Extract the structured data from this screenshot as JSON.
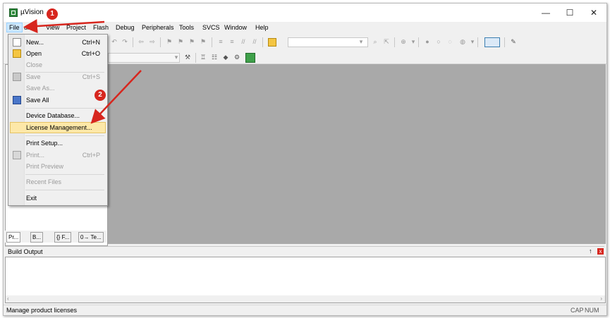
{
  "window": {
    "title": "µVision",
    "minimize": "—",
    "maximize": "☐",
    "close": "✕"
  },
  "menubar": {
    "items": [
      "File",
      "Edit",
      "View",
      "Project",
      "Flash",
      "Debug",
      "Peripherals",
      "Tools",
      "SVCS",
      "Window",
      "Help"
    ],
    "edit_visible": "dit"
  },
  "file_menu": {
    "items": [
      {
        "label": "New...",
        "shortcut": "Ctrl+N",
        "enabled": true,
        "icon": "new-file-icon"
      },
      {
        "label": "Open",
        "shortcut": "Ctrl+O",
        "enabled": true,
        "icon": "open-folder-icon"
      },
      {
        "label": "Close",
        "shortcut": "",
        "enabled": false,
        "icon": ""
      },
      {
        "label": "Save",
        "shortcut": "Ctrl+S",
        "enabled": false,
        "icon": "save-icon"
      },
      {
        "label": "Save As...",
        "shortcut": "",
        "enabled": false,
        "icon": ""
      },
      {
        "label": "Save All",
        "shortcut": "",
        "enabled": true,
        "icon": "save-all-icon"
      },
      {
        "label": "Device Database...",
        "shortcut": "",
        "enabled": true,
        "icon": ""
      },
      {
        "label": "License Management...",
        "shortcut": "",
        "enabled": true,
        "highlighted": true,
        "icon": ""
      },
      {
        "label": "Print Setup...",
        "shortcut": "",
        "enabled": true,
        "icon": ""
      },
      {
        "label": "Print...",
        "shortcut": "Ctrl+P",
        "enabled": false,
        "icon": "print-icon"
      },
      {
        "label": "Print Preview",
        "shortcut": "",
        "enabled": false,
        "icon": ""
      },
      {
        "label": "Recent Files",
        "shortcut": "",
        "enabled": false,
        "icon": ""
      },
      {
        "label": "Exit",
        "shortcut": "",
        "enabled": true,
        "icon": ""
      }
    ]
  },
  "panel_tabs": [
    {
      "label": "Pr...",
      "icon": "project-icon"
    },
    {
      "label": "B...",
      "icon": "books-icon"
    },
    {
      "label": "{} F...",
      "icon": "functions-icon"
    },
    {
      "label": "0→ Te...",
      "icon": "templates-icon"
    }
  ],
  "build_output": {
    "title": "Build Output",
    "pin": "↑",
    "close": "x"
  },
  "statusbar": {
    "message": "Manage product licenses",
    "cap": "CAP",
    "num": "NUM"
  },
  "annotations": {
    "badge1": "1",
    "badge2": "2",
    "color": "#d7261e"
  },
  "colors": {
    "editor_bg": "#a9a9a9",
    "highlight": "#fde8a8",
    "menu_active": "#cce8ff"
  }
}
